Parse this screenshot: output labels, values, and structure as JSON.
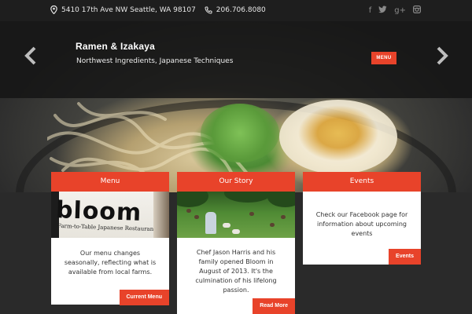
{
  "topbar": {
    "address": "5410 17th Ave NW Seattle, WA 98107",
    "phone": "206.706.8080",
    "social_icons": [
      "facebook-icon",
      "twitter-icon",
      "google-plus-icon",
      "instagram-icon"
    ]
  },
  "hero": {
    "title": "Ramen & Izakaya",
    "subtitle": "Northwest Ingredients, Japanese Techniques",
    "menu_label": "MENU"
  },
  "cards": {
    "menu": {
      "title": "Menu",
      "image_text": "bloom",
      "image_subtext": "Farm-to-Table Japanese Restaurant",
      "body": "Our menu changes seasonally, reflecting what is available from local farms.",
      "cta": "Current Menu"
    },
    "story": {
      "title": "Our Story",
      "body": "Chef Jason Harris and his family opened Bloom in August of 2013. It's the culmination of his lifelong passion.",
      "cta": "Read More"
    },
    "events": {
      "title": "Events",
      "body": "Check our Facebook page for information about upcoming events",
      "cta": "Events"
    }
  },
  "colors": {
    "accent": "#e8432a",
    "topbar_bg": "#1e1e1e",
    "page_bg": "#2a2a2a"
  }
}
